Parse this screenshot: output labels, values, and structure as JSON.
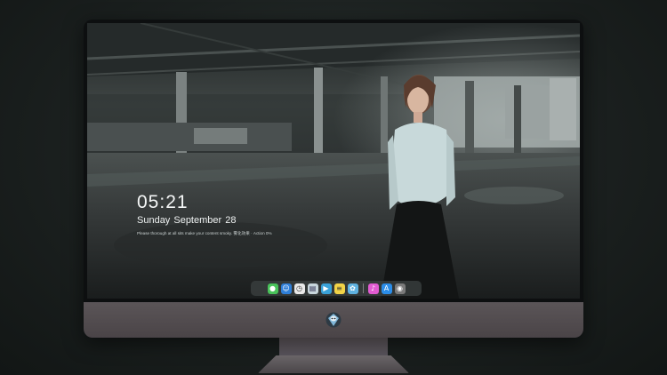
{
  "lock_screen": {
    "time": "05:21",
    "date": "Sunday September  28",
    "note": "Please thorough at all sits  make your content smoky. 雾化效果 · Action 0%"
  },
  "dock": {
    "apps": [
      {
        "name": "messages-icon",
        "glyph": "●",
        "color": "#49c25a"
      },
      {
        "name": "finder-icon",
        "glyph": "☺",
        "color": "#2f7fd8"
      },
      {
        "name": "clock-icon",
        "glyph": "◷",
        "color": "#e9e9e9"
      },
      {
        "name": "preview-icon",
        "glyph": "▤",
        "color": "#c8d6dc"
      },
      {
        "name": "final-cut-icon",
        "glyph": "▶",
        "color": "#3aa2d8"
      },
      {
        "name": "notes-icon",
        "glyph": "≡",
        "color": "#f2d347"
      },
      {
        "name": "photos-icon",
        "glyph": "✿",
        "color": "#5fb2e0"
      },
      {
        "name": "music-icon",
        "glyph": "♪",
        "color": "#e15bd1"
      },
      {
        "name": "app-store-icon",
        "glyph": "A",
        "color": "#2b8de8"
      },
      {
        "name": "camera-icon",
        "glyph": "◉",
        "color": "#7a7a7a"
      }
    ]
  },
  "colors": {
    "accent": "#2b8de8",
    "bezel": "#0d0f10",
    "chin": "#524c4f"
  }
}
